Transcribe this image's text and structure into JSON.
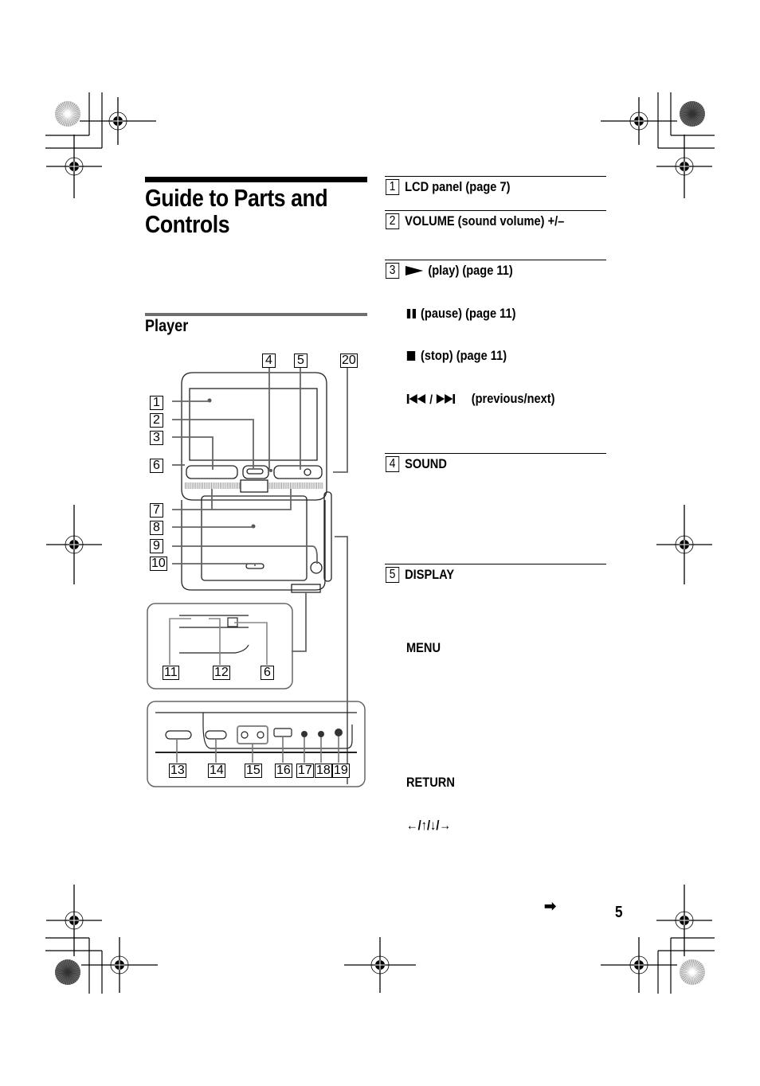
{
  "page": {
    "title_line1": "Guide to Parts and",
    "title_line2": "Controls",
    "section": "Player",
    "page_number": "5",
    "continue_arrow": "➡"
  },
  "items": [
    {
      "num": "1",
      "label": "LCD panel (page 7)"
    },
    {
      "num": "2",
      "label": "VOLUME (sound volume) +/–"
    },
    {
      "num": "3",
      "label": "(play) (page 11)",
      "sub": [
        "(pause) (page 11)",
        "(stop) (page 11)",
        "(previous/next)"
      ]
    },
    {
      "num": "4",
      "label": "SOUND"
    },
    {
      "num": "5",
      "label": "DISPLAY",
      "sub": [
        "MENU",
        "RETURN",
        "←/↑/↓/→"
      ]
    }
  ],
  "diagram": {
    "callouts_main": [
      "1",
      "2",
      "3",
      "6",
      "7",
      "8",
      "9",
      "10",
      "4",
      "5",
      "20"
    ],
    "callouts_side": [
      "11",
      "12",
      "6"
    ],
    "callouts_front": [
      "13",
      "14",
      "15",
      "16",
      "17",
      "18",
      "19"
    ],
    "play_mark": "►"
  }
}
